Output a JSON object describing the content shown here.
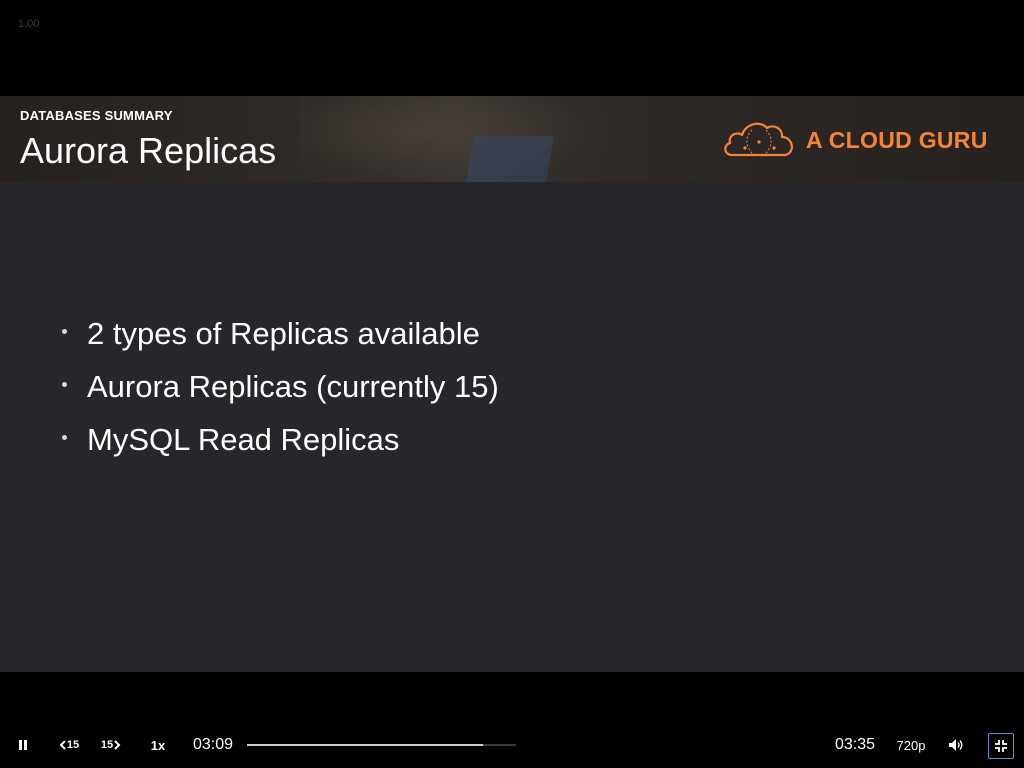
{
  "overlay": {
    "version": "1.00"
  },
  "slide": {
    "section": "DATABASES SUMMARY",
    "title": "Aurora Replicas",
    "logo_text": "A CLOUD GURU",
    "bullets": [
      "2 types of Replicas available",
      "Aurora Replicas (currently 15)",
      "MySQL Read Replicas"
    ]
  },
  "player": {
    "rewind_label": "15",
    "forward_label": "15",
    "speed": "1x",
    "current_time": "03:09",
    "duration": "03:35",
    "quality": "720p",
    "progress_fraction": 0.879,
    "icons": {
      "play_pause": "pause-icon",
      "rewind": "rewind-15-icon",
      "forward": "forward-15-icon",
      "volume": "volume-icon",
      "fullscreen": "exit-fullscreen-icon"
    }
  },
  "colors": {
    "brand_orange": "#f58536",
    "slide_background": "#27262b",
    "player_background": "#000000",
    "focus_outline": "#5b8fd6"
  }
}
